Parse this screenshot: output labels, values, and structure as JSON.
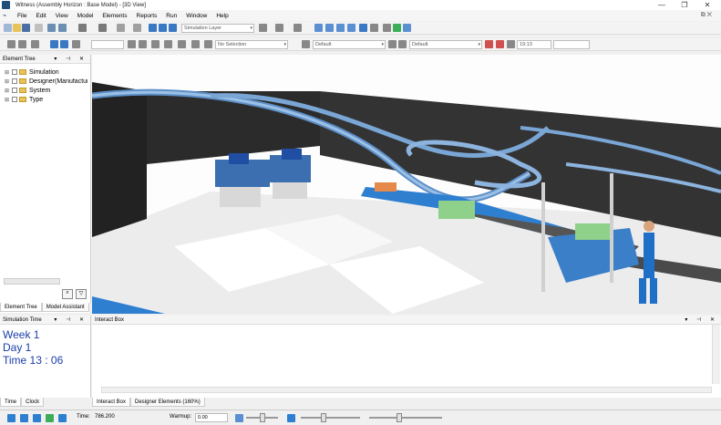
{
  "window": {
    "title": "Witness (Assembly Horizon : Base Model) - [3D View]",
    "minimize": "—",
    "restore": "❐",
    "close": "✕"
  },
  "menu": [
    "File",
    "Edit",
    "View",
    "Model",
    "Elements",
    "Reports",
    "Run",
    "Window",
    "Help"
  ],
  "toolbar1": {
    "layer_select": "Simulation Layer"
  },
  "toolbar2": {
    "selection_select": "No Selection",
    "style_select_1": "Default",
    "style_select_2": "Default",
    "time_field": "19:13"
  },
  "element_tree": {
    "title": "Element Tree",
    "pin": "⊣",
    "close": "✕",
    "items": [
      "Simulation",
      "Designer(Manufacturing)",
      "System",
      "Type"
    ],
    "tabs": [
      "Element Tree",
      "Model Assistant"
    ]
  },
  "sim_time": {
    "title": "Simulation Time",
    "week": "Week  1",
    "day": "Day   1",
    "time": "Time  13 : 06",
    "tabs": [
      "Time",
      "Clock"
    ]
  },
  "interact": {
    "title": "Interact Box",
    "tabs": [
      "Interact Box",
      "Designer Elements (160%)"
    ]
  },
  "status": {
    "time_label": "Time:",
    "time_value": "786.200",
    "warmup_label": "Warmup:",
    "warmup_value": "0.00"
  },
  "colors": {
    "accent": "#1f4e79",
    "conveyor_blue": "#2f7fd1",
    "wall": "#2a2a2a",
    "sim_text": "#1a3ea8"
  }
}
